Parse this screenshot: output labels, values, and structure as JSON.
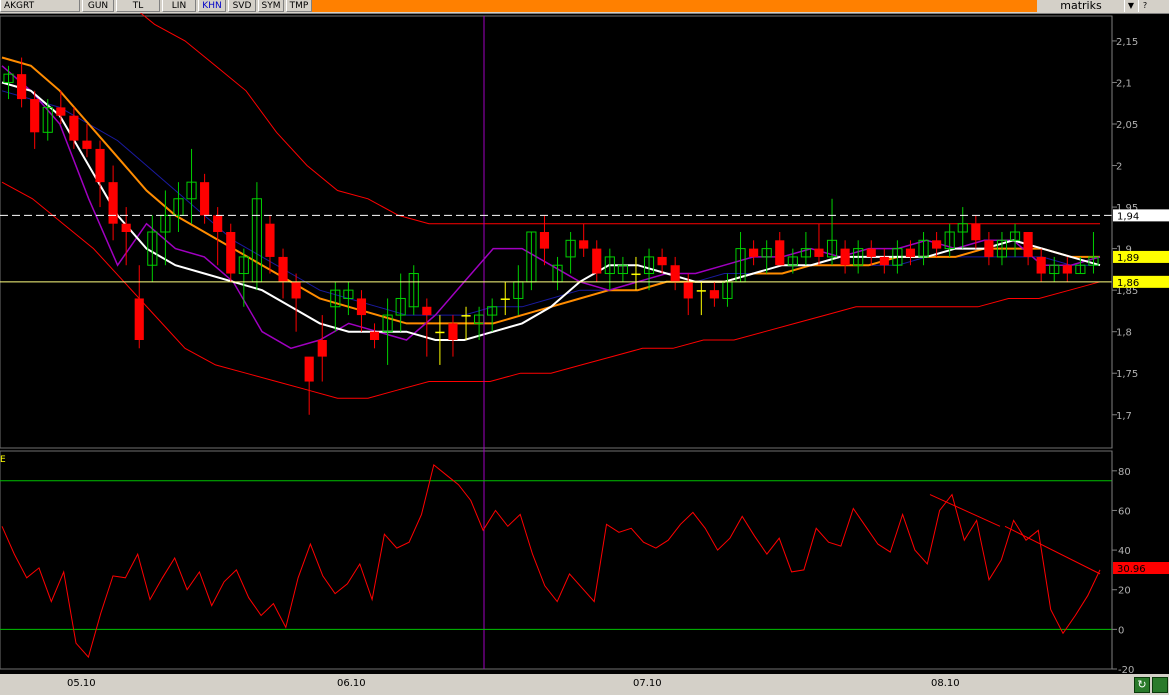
{
  "toolbar": {
    "symbol": "AKGRT",
    "buttons": [
      "GUN",
      "TL",
      "LIN",
      "KHN",
      "SVD",
      "SYM",
      "TMP"
    ],
    "active": "KHN",
    "brand": "matriks",
    "window_buttons": [
      "▼",
      "?"
    ]
  },
  "price_axis": {
    "ticks": [
      "2,15",
      "2,1",
      "2,05",
      "2",
      "1,95",
      "1,9",
      "1,85",
      "1,8",
      "1,75",
      "1,7"
    ],
    "markers": [
      {
        "label": "1,94",
        "value": 1.94,
        "color": "#ffffff",
        "text": "#000000"
      },
      {
        "label": "1,89",
        "value": 1.89,
        "color": "#ffff00",
        "text": "#000000"
      },
      {
        "label": "1,86",
        "value": 1.86,
        "color": "#ffff00",
        "text": "#000000"
      }
    ]
  },
  "osc_axis": {
    "ticks": [
      "80",
      "60",
      "40",
      "20",
      "0",
      "-20"
    ],
    "marker": {
      "label": "30.96",
      "value": 30.96,
      "color": "#ff0000",
      "text": "#000000"
    },
    "panel_label": "E"
  },
  "dates": [
    "05.10",
    "06.10",
    "07.10",
    "08.10"
  ],
  "colors": {
    "up": "#00d000",
    "down": "#ff0000",
    "doji": "#ffff00",
    "bands": "#ff0000",
    "ma_white": "#ffffff",
    "ma_orange": "#ff8c00",
    "ma_purple": "#a000c0",
    "ma_navy": "#1a1aa0",
    "ma_cyan": "#00c8c8",
    "osc": "#ff0000",
    "osc_levels": "#00c000"
  },
  "chart_data": {
    "type": "candlestick",
    "price": {
      "ylim": [
        1.66,
        2.18
      ],
      "candles": [
        [
          2.1,
          2.12,
          2.08,
          2.11
        ],
        [
          2.11,
          2.13,
          2.07,
          2.08
        ],
        [
          2.08,
          2.09,
          2.02,
          2.04
        ],
        [
          2.04,
          2.08,
          2.03,
          2.07
        ],
        [
          2.07,
          2.09,
          2.05,
          2.06
        ],
        [
          2.06,
          2.07,
          2.02,
          2.03
        ],
        [
          2.03,
          2.05,
          2.01,
          2.02
        ],
        [
          2.02,
          2.03,
          1.95,
          1.98
        ],
        [
          1.98,
          2.0,
          1.91,
          1.93
        ],
        [
          1.93,
          1.95,
          1.88,
          1.92
        ],
        [
          1.84,
          1.88,
          1.78,
          1.79
        ],
        [
          1.88,
          1.94,
          1.86,
          1.92
        ],
        [
          1.92,
          1.97,
          1.88,
          1.94
        ],
        [
          1.94,
          1.98,
          1.92,
          1.96
        ],
        [
          1.96,
          2.02,
          1.93,
          1.98
        ],
        [
          1.98,
          1.99,
          1.93,
          1.94
        ],
        [
          1.94,
          1.95,
          1.88,
          1.92
        ],
        [
          1.92,
          1.93,
          1.86,
          1.87
        ],
        [
          1.87,
          1.9,
          1.83,
          1.89
        ],
        [
          1.86,
          1.98,
          1.85,
          1.96
        ],
        [
          1.93,
          1.94,
          1.87,
          1.89
        ],
        [
          1.89,
          1.9,
          1.84,
          1.86
        ],
        [
          1.86,
          1.87,
          1.8,
          1.84
        ],
        [
          1.77,
          1.76,
          1.7,
          1.74
        ],
        [
          1.79,
          1.82,
          1.74,
          1.77
        ],
        [
          1.83,
          1.86,
          1.8,
          1.85
        ],
        [
          1.84,
          1.86,
          1.82,
          1.85
        ],
        [
          1.84,
          1.85,
          1.8,
          1.82
        ],
        [
          1.8,
          1.81,
          1.78,
          1.79
        ],
        [
          1.8,
          1.84,
          1.76,
          1.82
        ],
        [
          1.82,
          1.87,
          1.8,
          1.84
        ],
        [
          1.83,
          1.88,
          1.82,
          1.87
        ],
        [
          1.83,
          1.84,
          1.77,
          1.82
        ],
        [
          1.8,
          1.82,
          1.76,
          1.8
        ],
        [
          1.81,
          1.82,
          1.77,
          1.79
        ],
        [
          1.82,
          1.83,
          1.79,
          1.82
        ],
        [
          1.81,
          1.83,
          1.79,
          1.82
        ],
        [
          1.82,
          1.84,
          1.8,
          1.83
        ],
        [
          1.84,
          1.86,
          1.82,
          1.84
        ],
        [
          1.84,
          1.88,
          1.82,
          1.86
        ],
        [
          1.86,
          1.92,
          1.85,
          1.92
        ],
        [
          1.92,
          1.94,
          1.88,
          1.9
        ],
        [
          1.86,
          1.89,
          1.85,
          1.88
        ],
        [
          1.89,
          1.92,
          1.87,
          1.91
        ],
        [
          1.91,
          1.93,
          1.89,
          1.9
        ],
        [
          1.9,
          1.91,
          1.86,
          1.87
        ],
        [
          1.87,
          1.9,
          1.85,
          1.89
        ],
        [
          1.87,
          1.89,
          1.86,
          1.88
        ],
        [
          1.87,
          1.89,
          1.85,
          1.87
        ],
        [
          1.87,
          1.9,
          1.85,
          1.89
        ],
        [
          1.89,
          1.9,
          1.87,
          1.88
        ],
        [
          1.88,
          1.89,
          1.85,
          1.86
        ],
        [
          1.86,
          1.87,
          1.82,
          1.84
        ],
        [
          1.85,
          1.86,
          1.82,
          1.85
        ],
        [
          1.85,
          1.86,
          1.83,
          1.84
        ],
        [
          1.84,
          1.87,
          1.83,
          1.86
        ],
        [
          1.86,
          1.92,
          1.86,
          1.9
        ],
        [
          1.9,
          1.91,
          1.88,
          1.89
        ],
        [
          1.89,
          1.91,
          1.87,
          1.9
        ],
        [
          1.91,
          1.92,
          1.88,
          1.88
        ],
        [
          1.88,
          1.9,
          1.87,
          1.89
        ],
        [
          1.89,
          1.92,
          1.88,
          1.9
        ],
        [
          1.9,
          1.93,
          1.88,
          1.89
        ],
        [
          1.89,
          1.96,
          1.88,
          1.91
        ],
        [
          1.9,
          1.91,
          1.87,
          1.88
        ],
        [
          1.88,
          1.91,
          1.87,
          1.9
        ],
        [
          1.9,
          1.91,
          1.88,
          1.89
        ],
        [
          1.89,
          1.9,
          1.87,
          1.88
        ],
        [
          1.88,
          1.91,
          1.87,
          1.9
        ],
        [
          1.9,
          1.91,
          1.88,
          1.89
        ],
        [
          1.89,
          1.92,
          1.88,
          1.91
        ],
        [
          1.91,
          1.92,
          1.89,
          1.9
        ],
        [
          1.9,
          1.93,
          1.89,
          1.92
        ],
        [
          1.92,
          1.95,
          1.9,
          1.93
        ],
        [
          1.93,
          1.94,
          1.9,
          1.91
        ],
        [
          1.91,
          1.92,
          1.88,
          1.89
        ],
        [
          1.89,
          1.92,
          1.88,
          1.91
        ],
        [
          1.91,
          1.93,
          1.89,
          1.92
        ],
        [
          1.92,
          1.92,
          1.88,
          1.89
        ],
        [
          1.89,
          1.9,
          1.86,
          1.87
        ],
        [
          1.87,
          1.89,
          1.86,
          1.88
        ],
        [
          1.88,
          1.89,
          1.86,
          1.87
        ],
        [
          1.87,
          1.89,
          1.87,
          1.88
        ],
        [
          1.88,
          1.92,
          1.87,
          1.89
        ]
      ],
      "bb_upper": [
        2.23,
        2.25,
        2.24,
        2.23,
        2.2,
        2.17,
        2.15,
        2.12,
        2.09,
        2.04,
        2.0,
        1.97,
        1.96,
        1.94,
        1.93,
        1.93,
        1.93,
        1.93,
        1.93,
        1.93,
        1.93,
        1.93,
        1.93,
        1.93,
        1.93,
        1.93,
        1.93,
        1.93,
        1.93,
        1.93,
        1.93,
        1.93,
        1.93,
        1.93,
        1.93,
        1.93,
        1.93
      ],
      "bb_lower": [
        1.98,
        1.96,
        1.93,
        1.9,
        1.86,
        1.82,
        1.78,
        1.76,
        1.75,
        1.74,
        1.73,
        1.72,
        1.72,
        1.73,
        1.74,
        1.74,
        1.74,
        1.75,
        1.75,
        1.76,
        1.77,
        1.78,
        1.78,
        1.79,
        1.79,
        1.8,
        1.81,
        1.82,
        1.83,
        1.83,
        1.83,
        1.83,
        1.83,
        1.84,
        1.84,
        1.85,
        1.86
      ],
      "ma_white": [
        2.1,
        2.09,
        2.06,
        2.0,
        1.94,
        1.9,
        1.88,
        1.87,
        1.86,
        1.85,
        1.83,
        1.81,
        1.8,
        1.8,
        1.8,
        1.79,
        1.79,
        1.8,
        1.81,
        1.83,
        1.86,
        1.88,
        1.88,
        1.87,
        1.86,
        1.86,
        1.87,
        1.88,
        1.88,
        1.89,
        1.89,
        1.89,
        1.89,
        1.9,
        1.9,
        1.91,
        1.9,
        1.89,
        1.88
      ],
      "ma_orange": [
        2.13,
        2.12,
        2.09,
        2.05,
        2.01,
        1.97,
        1.94,
        1.92,
        1.9,
        1.88,
        1.86,
        1.84,
        1.83,
        1.82,
        1.81,
        1.81,
        1.81,
        1.81,
        1.82,
        1.83,
        1.84,
        1.85,
        1.85,
        1.86,
        1.86,
        1.86,
        1.87,
        1.87,
        1.88,
        1.88,
        1.88,
        1.89,
        1.89,
        1.89,
        1.9,
        1.9,
        1.9,
        1.89,
        1.89
      ],
      "ma_navy": [
        2.09,
        2.08,
        2.07,
        2.05,
        2.03,
        2.0,
        1.97,
        1.94,
        1.91,
        1.89,
        1.87,
        1.85,
        1.84,
        1.83,
        1.82,
        1.82,
        1.82,
        1.83,
        1.83,
        1.84,
        1.85,
        1.85,
        1.86,
        1.86,
        1.86,
        1.87,
        1.87,
        1.87,
        1.88,
        1.88,
        1.88,
        1.88,
        1.89,
        1.89,
        1.89,
        1.89,
        1.89,
        1.88,
        1.88
      ],
      "ma_purple": [
        2.12,
        2.09,
        2.05,
        1.96,
        1.88,
        1.93,
        1.9,
        1.89,
        1.86,
        1.8,
        1.78,
        1.79,
        1.81,
        1.8,
        1.79,
        1.82,
        1.86,
        1.9,
        1.9,
        1.88,
        1.86,
        1.85,
        1.86,
        1.87,
        1.87,
        1.88,
        1.89,
        1.89,
        1.9,
        1.89,
        1.9,
        1.9,
        1.91,
        1.9,
        1.91,
        1.91,
        1.88,
        1.88,
        1.89
      ]
    },
    "oscillator": {
      "ylim": [
        -20,
        90
      ],
      "levels": [
        75,
        0
      ],
      "values": [
        52,
        38,
        26,
        31,
        14,
        29,
        -7,
        -14,
        8,
        27,
        26,
        38,
        15,
        26,
        36,
        20,
        29,
        12,
        24,
        30,
        16,
        7,
        13,
        1,
        26,
        43,
        27,
        18,
        23,
        33,
        15,
        48,
        41,
        44,
        58,
        83,
        78,
        73,
        65,
        50,
        60,
        52,
        58,
        38,
        22,
        14,
        28,
        21,
        14,
        53,
        49,
        51,
        44,
        41,
        45,
        53,
        59,
        51,
        40,
        46,
        57,
        47,
        38,
        46,
        29,
        30,
        51,
        44,
        42,
        61,
        52,
        43,
        39,
        58,
        40,
        33,
        60,
        68,
        45,
        55,
        25,
        35,
        55,
        45,
        50,
        10,
        -2,
        7,
        17,
        30
      ]
    }
  }
}
